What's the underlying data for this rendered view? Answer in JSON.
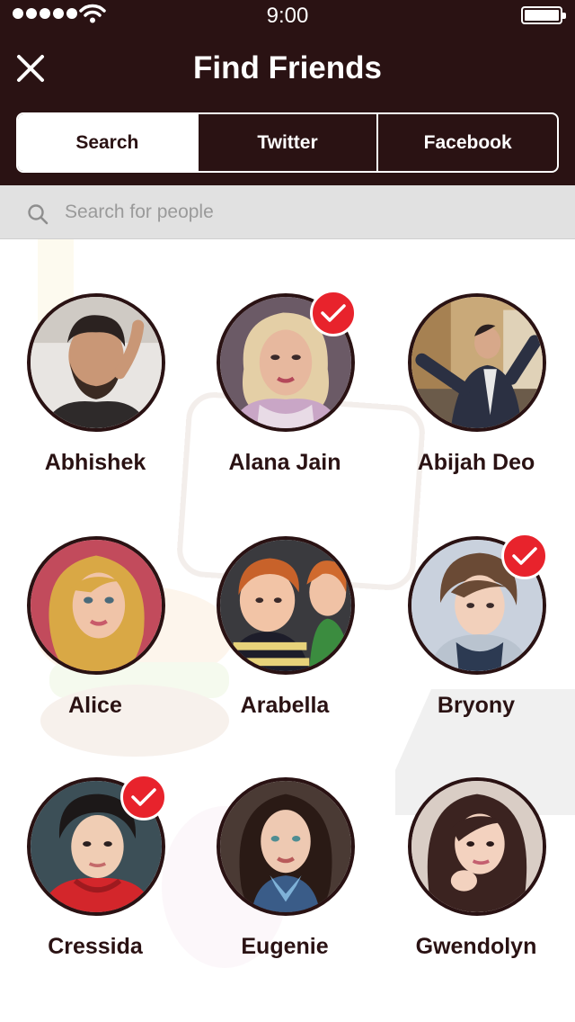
{
  "status_bar": {
    "time": "9:00",
    "signal_bars": 5,
    "battery_level": 1.0
  },
  "header": {
    "title": "Find Friends",
    "close_icon": "close-icon",
    "tabs": [
      {
        "label": "Search",
        "active": true
      },
      {
        "label": "Twitter",
        "active": false
      },
      {
        "label": "Facebook",
        "active": false
      }
    ]
  },
  "search": {
    "placeholder": "Search for people",
    "icon": "search-icon"
  },
  "friends": [
    {
      "name": "Abhishek",
      "selected": false
    },
    {
      "name": "Alana Jain",
      "selected": true
    },
    {
      "name": "Abijah Deo",
      "selected": false
    },
    {
      "name": "Alice",
      "selected": false
    },
    {
      "name": "Arabella",
      "selected": false
    },
    {
      "name": "Bryony",
      "selected": true
    },
    {
      "name": "Cressida",
      "selected": true
    },
    {
      "name": "Eugenie",
      "selected": false
    },
    {
      "name": "Gwendolyn",
      "selected": false
    }
  ],
  "colors": {
    "brand": "#2a1213",
    "check": "#e8232c",
    "search_bg": "#e1e1e1"
  }
}
